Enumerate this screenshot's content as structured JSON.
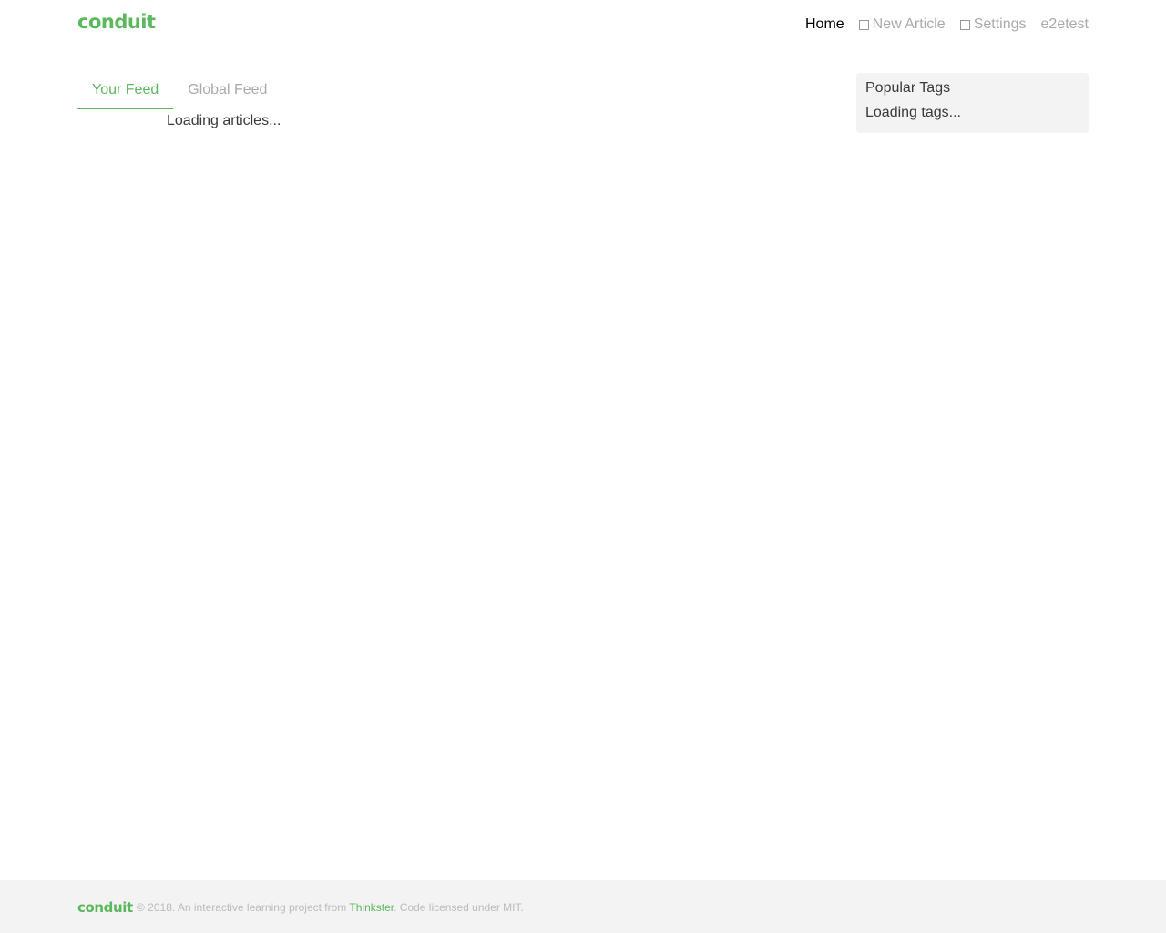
{
  "navbar": {
    "brand": "conduit",
    "links": [
      {
        "label": "Home",
        "active": true
      },
      {
        "label": "New Article",
        "icon": "compose-icon"
      },
      {
        "label": "Settings",
        "icon": "gear-icon"
      },
      {
        "label": "e2etest"
      }
    ]
  },
  "feed": {
    "tabs": [
      {
        "label": "Your Feed",
        "active": true
      },
      {
        "label": "Global Feed",
        "active": false
      }
    ],
    "loading_text": "Loading articles..."
  },
  "sidebar": {
    "title": "Popular Tags",
    "loading_text": "Loading tags..."
  },
  "footer": {
    "brand": "conduit",
    "text_prefix": "© 2018. An interactive learning project from ",
    "link_text": "Thinkster",
    "text_suffix": ". Code licensed under MIT."
  },
  "colors": {
    "accent": "#5cb85c",
    "muted": "#aaaaaa",
    "panel": "#f3f3f3"
  }
}
